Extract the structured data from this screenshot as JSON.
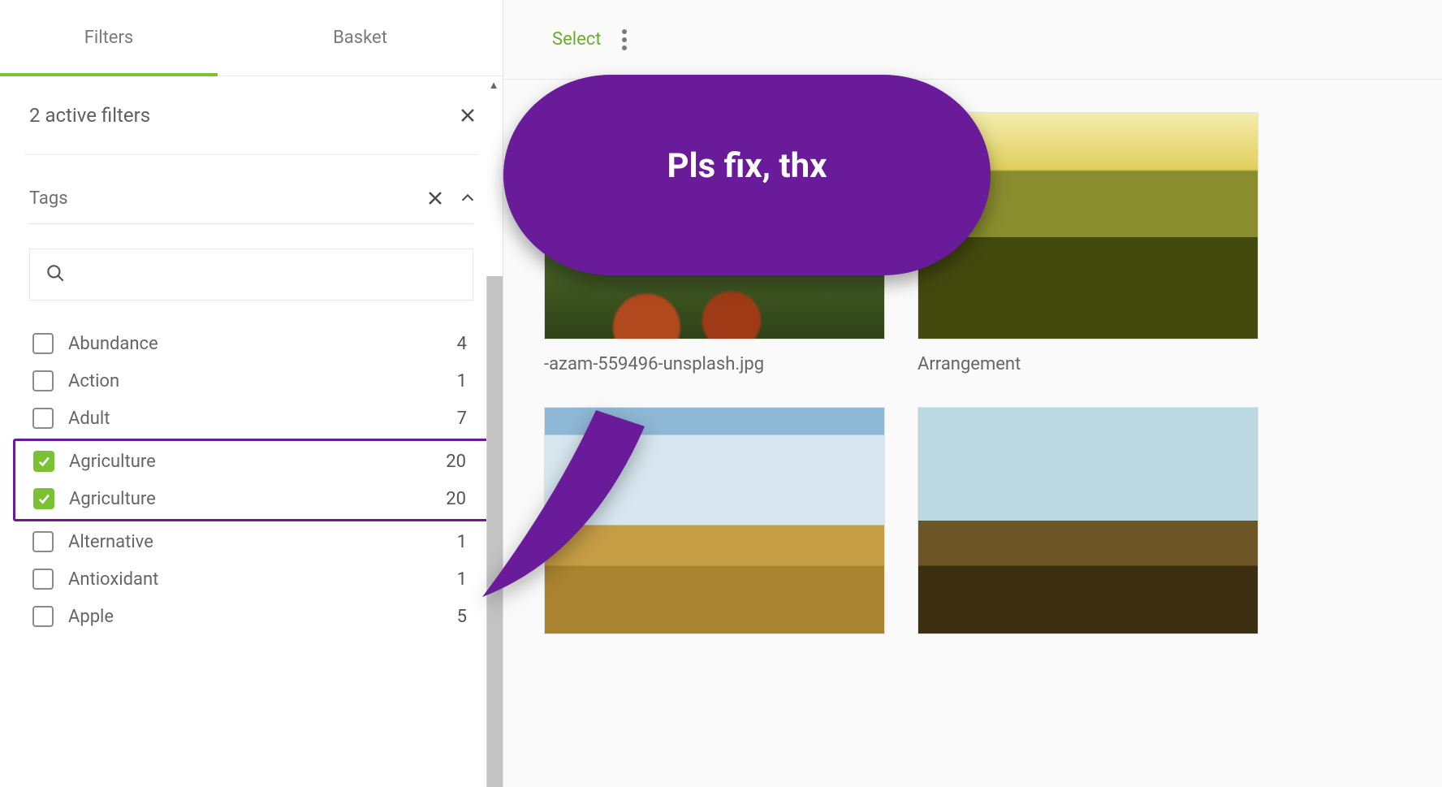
{
  "tabs": {
    "filters": "Filters",
    "basket": "Basket"
  },
  "active_filters": {
    "label": "2 active filters"
  },
  "tags_section": {
    "title": "Tags"
  },
  "search": {
    "placeholder": ""
  },
  "tags": [
    {
      "label": "Abundance",
      "count": "4",
      "checked": false
    },
    {
      "label": "Action",
      "count": "1",
      "checked": false
    },
    {
      "label": "Adult",
      "count": "7",
      "checked": false
    },
    {
      "label": "Agriculture",
      "count": "20",
      "checked": true
    },
    {
      "label": "Agriculture",
      "count": "20",
      "checked": true
    },
    {
      "label": "Alternative",
      "count": "1",
      "checked": false
    },
    {
      "label": "Antioxidant",
      "count": "1",
      "checked": false
    },
    {
      "label": "Apple",
      "count": "5",
      "checked": false
    }
  ],
  "toolbar": {
    "select": "Select"
  },
  "cards": [
    {
      "caption": "-azam-559496-unsplash.jpg"
    },
    {
      "caption": "Arrangement"
    },
    {
      "caption": ""
    },
    {
      "caption": ""
    }
  ],
  "annotation": {
    "text": "Pls fix, thx"
  },
  "colors": {
    "accent": "#7ac134",
    "annotation": "#6a1b9a"
  }
}
